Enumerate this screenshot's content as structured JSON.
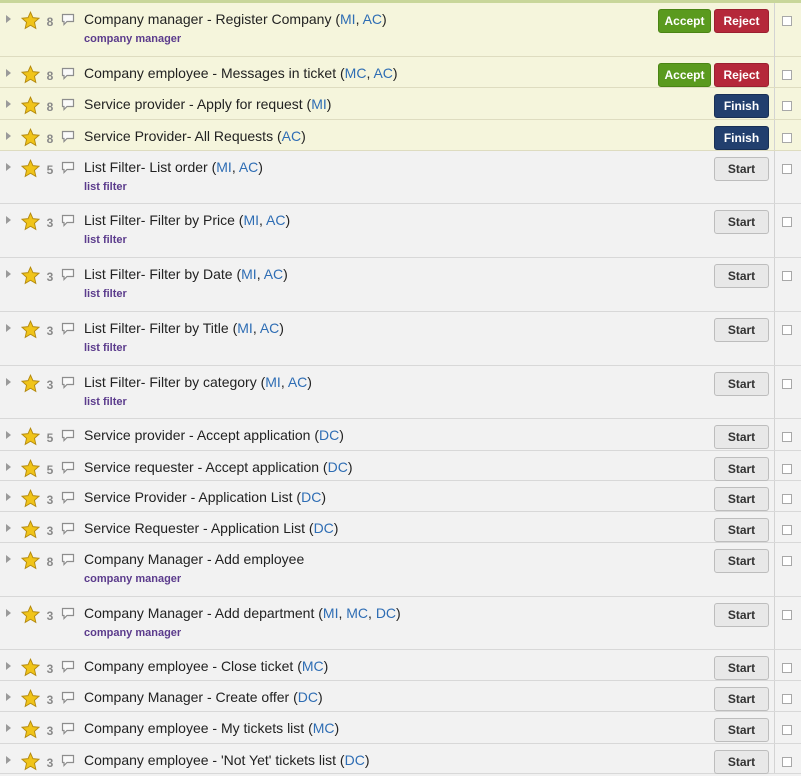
{
  "tasks": [
    {
      "priority": "8",
      "title": "Company manager - Register Company  (",
      "tags": [
        "MI",
        "AC"
      ],
      "label": "company manager",
      "actions": [
        "Accept",
        "Reject"
      ],
      "highlight": true
    },
    {
      "priority": "8",
      "title": "Company employee - Messages in ticket (",
      "tags": [
        "MC",
        "AC"
      ],
      "label": "",
      "actions": [
        "Accept",
        "Reject"
      ],
      "highlight": true
    },
    {
      "priority": "8",
      "title": "Service provider - Apply for request (",
      "tags": [
        "MI"
      ],
      "label": "",
      "actions": [
        "Finish"
      ],
      "highlight": true
    },
    {
      "priority": "8",
      "title": "Service Provider- All Requests (",
      "tags": [
        "AC"
      ],
      "label": "",
      "actions": [
        "Finish"
      ],
      "highlight": true
    },
    {
      "priority": "5",
      "title": "List Filter- List order (",
      "tags": [
        "MI",
        "AC"
      ],
      "label": "list filter",
      "actions": [
        "Start"
      ],
      "highlight": false
    },
    {
      "priority": "3",
      "title": "List Filter- Filter by Price (",
      "tags": [
        "MI",
        "AC"
      ],
      "label": "list filter",
      "actions": [
        "Start"
      ],
      "highlight": false
    },
    {
      "priority": "3",
      "title": "List Filter- Filter by Date (",
      "tags": [
        "MI",
        "AC"
      ],
      "label": "list filter",
      "actions": [
        "Start"
      ],
      "highlight": false
    },
    {
      "priority": "3",
      "title": "List Filter- Filter by Title (",
      "tags": [
        "MI",
        "AC"
      ],
      "label": "list filter",
      "actions": [
        "Start"
      ],
      "highlight": false
    },
    {
      "priority": "3",
      "title": "List Filter- Filter by category (",
      "tags": [
        "MI",
        "AC"
      ],
      "label": "list filter",
      "actions": [
        "Start"
      ],
      "highlight": false
    },
    {
      "priority": "5",
      "title": "Service provider - Accept application (",
      "tags": [
        "DC"
      ],
      "label": "",
      "actions": [
        "Start"
      ],
      "highlight": false
    },
    {
      "priority": "5",
      "title": "Service requester - Accept application (",
      "tags": [
        "DC"
      ],
      "label": "",
      "actions": [
        "Start"
      ],
      "highlight": false
    },
    {
      "priority": "3",
      "title": "Service Provider - Application List (",
      "tags": [
        "DC"
      ],
      "label": "",
      "actions": [
        "Start"
      ],
      "highlight": false
    },
    {
      "priority": "3",
      "title": "Service Requester - Application List (",
      "tags": [
        "DC"
      ],
      "label": "",
      "actions": [
        "Start"
      ],
      "highlight": false
    },
    {
      "priority": "8",
      "title": "Company Manager - Add employee",
      "tags": [],
      "label": "company manager",
      "actions": [
        "Start"
      ],
      "highlight": false
    },
    {
      "priority": "3",
      "title": "Company Manager - Add department (",
      "tags": [
        "MI",
        "MC",
        "DC"
      ],
      "label": "company manager",
      "actions": [
        "Start"
      ],
      "highlight": false
    },
    {
      "priority": "3",
      "title": "Company employee - Close ticket (",
      "tags": [
        "MC"
      ],
      "label": "",
      "actions": [
        "Start"
      ],
      "highlight": false
    },
    {
      "priority": "3",
      "title": "Company Manager - Create offer (",
      "tags": [
        "DC"
      ],
      "label": "",
      "actions": [
        "Start"
      ],
      "highlight": false
    },
    {
      "priority": "3",
      "title": "Company employee - My tickets list (",
      "tags": [
        "MC"
      ],
      "label": "",
      "actions": [
        "Start"
      ],
      "highlight": false
    },
    {
      "priority": "3",
      "title": "Company employee - 'Not Yet' tickets list (",
      "tags": [
        "DC"
      ],
      "label": "",
      "actions": [
        "Start"
      ],
      "highlight": false
    }
  ]
}
